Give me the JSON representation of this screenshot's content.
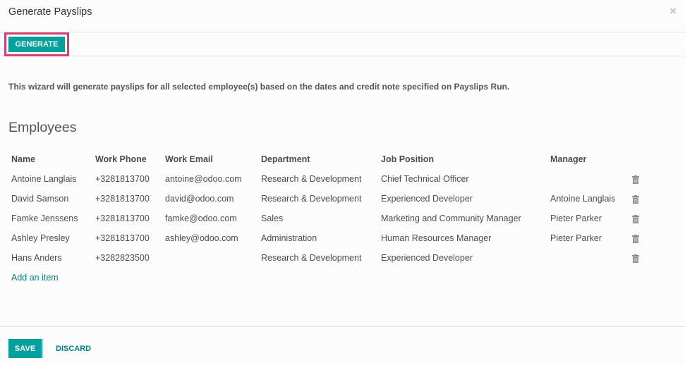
{
  "modal": {
    "title": "Generate Payslips",
    "close_icon": "close-icon"
  },
  "toolbar": {
    "generate_label": "GENERATE",
    "highlight_color": "#d63e6e"
  },
  "description": "This wizard will generate payslips for all selected employee(s) based on the dates and credit note specified on Payslips Run.",
  "employees": {
    "title": "Employees",
    "columns": [
      "Name",
      "Work Phone",
      "Work Email",
      "Department",
      "Job Position",
      "Manager"
    ],
    "rows": [
      {
        "name": "Antoine Langlais",
        "phone": "+3281813700",
        "email": "antoine@odoo.com",
        "department": "Research & Development",
        "job": "Chief Technical Officer",
        "manager": ""
      },
      {
        "name": "David Samson",
        "phone": "+3281813700",
        "email": "david@odoo.com",
        "department": "Research & Development",
        "job": "Experienced Developer",
        "manager": "Antoine Langlais"
      },
      {
        "name": "Famke Jenssens",
        "phone": "+3281813700",
        "email": "famke@odoo.com",
        "department": "Sales",
        "job": "Marketing and Community Manager",
        "manager": "Pieter Parker"
      },
      {
        "name": "Ashley Presley",
        "phone": "+3281813700",
        "email": "ashley@odoo.com",
        "department": "Administration",
        "job": "Human Resources Manager",
        "manager": "Pieter Parker"
      },
      {
        "name": "Hans Anders",
        "phone": "+3282823500",
        "email": "",
        "department": "Research & Development",
        "job": "Experienced Developer",
        "manager": ""
      }
    ],
    "add_item_label": "Add an item",
    "row_action_icon": "trash-icon"
  },
  "footer": {
    "save_label": "SAVE",
    "discard_label": "DISCARD"
  },
  "colors": {
    "primary": "#00a09d",
    "link": "#017e84"
  }
}
